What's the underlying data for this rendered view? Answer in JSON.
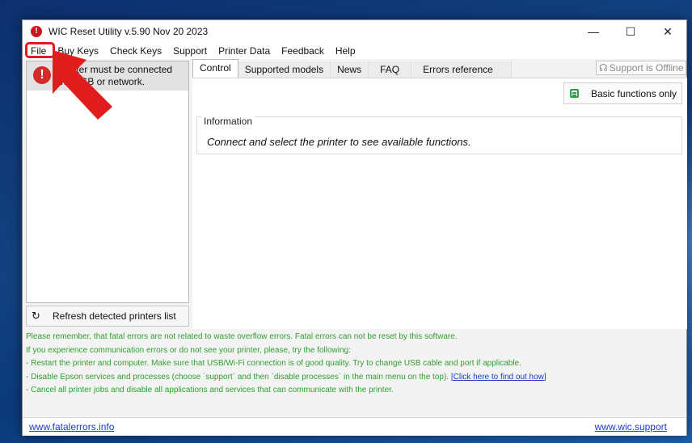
{
  "window": {
    "title": "WIC Reset Utility v.5.90 Nov 20 2023",
    "controls": {
      "minimize": "—",
      "maximize": "☐",
      "close": "✕"
    }
  },
  "menu": [
    "File",
    "Buy Keys",
    "Check Keys",
    "Support",
    "Printer Data",
    "Feedback",
    "Help"
  ],
  "left_panel": {
    "printer_message": "Printer must be connected via USB or network.",
    "refresh_label": "Refresh detected printers list"
  },
  "tabs": [
    "Control",
    "Supported models",
    "News",
    "FAQ",
    "Errors reference"
  ],
  "support_status": "Support is Offline",
  "control": {
    "basic_button": "Basic functions only",
    "info_title": "Information",
    "info_message": "Connect and select the printer to see available functions."
  },
  "notes": {
    "line1": "Please remember, that fatal errors are not related to waste overflow errors. Fatal errors can not be reset by this software.",
    "line2": "If you experience communication errors or do not see your printer, please, try the following:",
    "line3": "- Restart the printer and computer. Make sure that USB/Wi-Fi connection is of good quality. Try to change USB cable and port if applicable.",
    "line4": "- Disable Epson services and processes (choose `support` and then `disable processes` in the main menu on the top).",
    "line4_link": "[Click here to find out how]",
    "line5": "- Cancel all printer jobs  and disable all applications and services that can communicate with the printer."
  },
  "footer": {
    "left_link": "www.fatalerrors.info",
    "right_link": "www.wic.support"
  },
  "colors": {
    "annotation_red": "#e11c1c",
    "notes_green": "#2f9f2f",
    "link_blue": "#1a3cc9",
    "warning_red": "#d42a2a"
  }
}
